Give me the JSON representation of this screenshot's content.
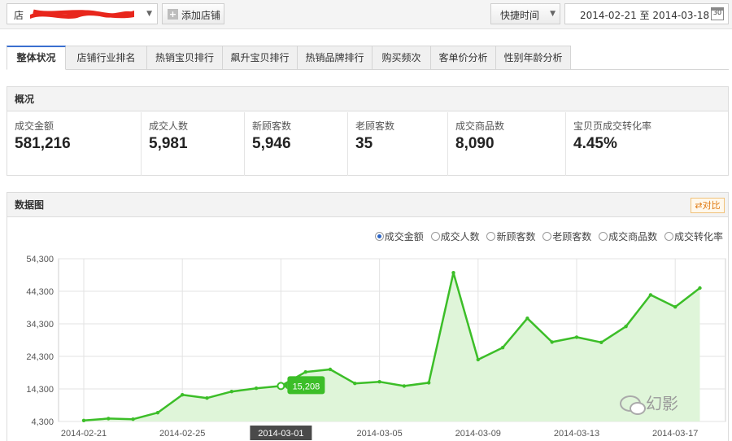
{
  "toolbar": {
    "store_prefix": "店",
    "add_store_label": "添加店铺",
    "quick_time_label": "快捷时间",
    "date_range": "2014-02-21 至 2014-03-18",
    "calendar_text": "30"
  },
  "tabs": [
    {
      "label": "整体状况",
      "active": true
    },
    {
      "label": "店铺行业排名"
    },
    {
      "label": "热销宝贝排行"
    },
    {
      "label": "飙升宝贝排行"
    },
    {
      "label": "热销品牌排行"
    },
    {
      "label": "购买频次"
    },
    {
      "label": "客单价分析"
    },
    {
      "label": "性别年龄分析"
    }
  ],
  "overview": {
    "title": "概况",
    "metrics": [
      {
        "label": "成交金额",
        "value": "581,216"
      },
      {
        "label": "成交人数",
        "value": "5,981"
      },
      {
        "label": "新顾客数",
        "value": "5,946"
      },
      {
        "label": "老顾客数",
        "value": "35"
      },
      {
        "label": "成交商品数",
        "value": "8,090"
      },
      {
        "label": "宝贝页成交转化率",
        "value": "4.45%"
      }
    ]
  },
  "chart_panel": {
    "title": "数据图",
    "compare_label": "对比",
    "radio_options": [
      "成交金额",
      "成交人数",
      "新顾客数",
      "老顾客数",
      "成交商品数",
      "成交转化率"
    ],
    "selected_option": "成交金额"
  },
  "colors": {
    "line": "#3cbe28",
    "area": "#dff5d9",
    "tooltip": "#3cbe28",
    "highlight_tick_bg": "#4a4a4a"
  },
  "watermark": "幻影",
  "chart_data": {
    "type": "area",
    "title": "",
    "xlabel": "",
    "ylabel": "",
    "ylim": [
      4300,
      54300
    ],
    "y_ticks": [
      "4,300",
      "14,300",
      "24,300",
      "34,300",
      "44,300",
      "54,300"
    ],
    "x_ticks": [
      "2014-02-21",
      "2014-02-25",
      "2014-03-01",
      "2014-03-05",
      "2014-03-09",
      "2014-03-13",
      "2014-03-17"
    ],
    "highlight_x": "2014-03-01",
    "tooltip": {
      "x": "2014-03-01",
      "label": "15,208"
    },
    "x": [
      "2014-02-21",
      "2014-02-22",
      "2014-02-23",
      "2014-02-24",
      "2014-02-25",
      "2014-02-26",
      "2014-02-27",
      "2014-02-28",
      "2014-03-01",
      "2014-03-02",
      "2014-03-03",
      "2014-03-04",
      "2014-03-05",
      "2014-03-06",
      "2014-03-07",
      "2014-03-08",
      "2014-03-09",
      "2014-03-10",
      "2014-03-11",
      "2014-03-12",
      "2014-03-13",
      "2014-03-14",
      "2014-03-15",
      "2014-03-16",
      "2014-03-17",
      "2014-03-18"
    ],
    "series": [
      {
        "values": [
          4600,
          5200,
          5000,
          7000,
          12500,
          11500,
          13500,
          14500,
          15208,
          19500,
          20300,
          16000,
          16500,
          15200,
          16200,
          50000,
          23300,
          27000,
          36000,
          28700,
          30200,
          28600,
          33500,
          43200,
          39500,
          45300
        ]
      }
    ],
    "grid": true
  }
}
